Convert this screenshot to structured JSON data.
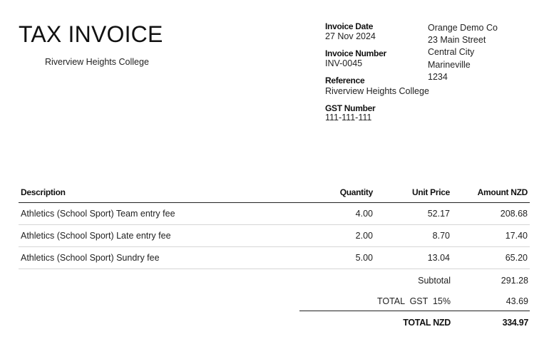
{
  "invoice": {
    "title": "TAX INVOICE",
    "bill_to": "Riverview Heights College",
    "details": [
      {
        "label": "Invoice Date",
        "value": "27 Nov 2024"
      },
      {
        "label": "Invoice Number",
        "value": "INV-0045"
      },
      {
        "label": "Reference",
        "value": "Riverview Heights College"
      },
      {
        "label": "GST Number",
        "value": "111-111-111"
      }
    ],
    "from": [
      "Orange Demo Co",
      "23 Main Street",
      "Central City",
      "Marineville",
      "1234"
    ]
  },
  "table": {
    "headers": {
      "description": "Description",
      "quantity": "Quantity",
      "unit_price": "Unit Price",
      "amount": "Amount NZD"
    },
    "rows": [
      {
        "description": "Athletics (School Sport) Team entry fee",
        "quantity": "4.00",
        "unit_price": "52.17",
        "amount": "208.68"
      },
      {
        "description": "Athletics (School Sport) Late entry fee",
        "quantity": "2.00",
        "unit_price": "8.70",
        "amount": "17.40"
      },
      {
        "description": "Athletics (School Sport) Sundry fee",
        "quantity": "5.00",
        "unit_price": "13.04",
        "amount": "65.20"
      }
    ]
  },
  "totals": {
    "subtotal_label": "Subtotal",
    "subtotal": "291.28",
    "gst_label": "TOTAL  GST  15%",
    "gst": "43.69",
    "total_label": "TOTAL NZD",
    "total": "334.97"
  }
}
